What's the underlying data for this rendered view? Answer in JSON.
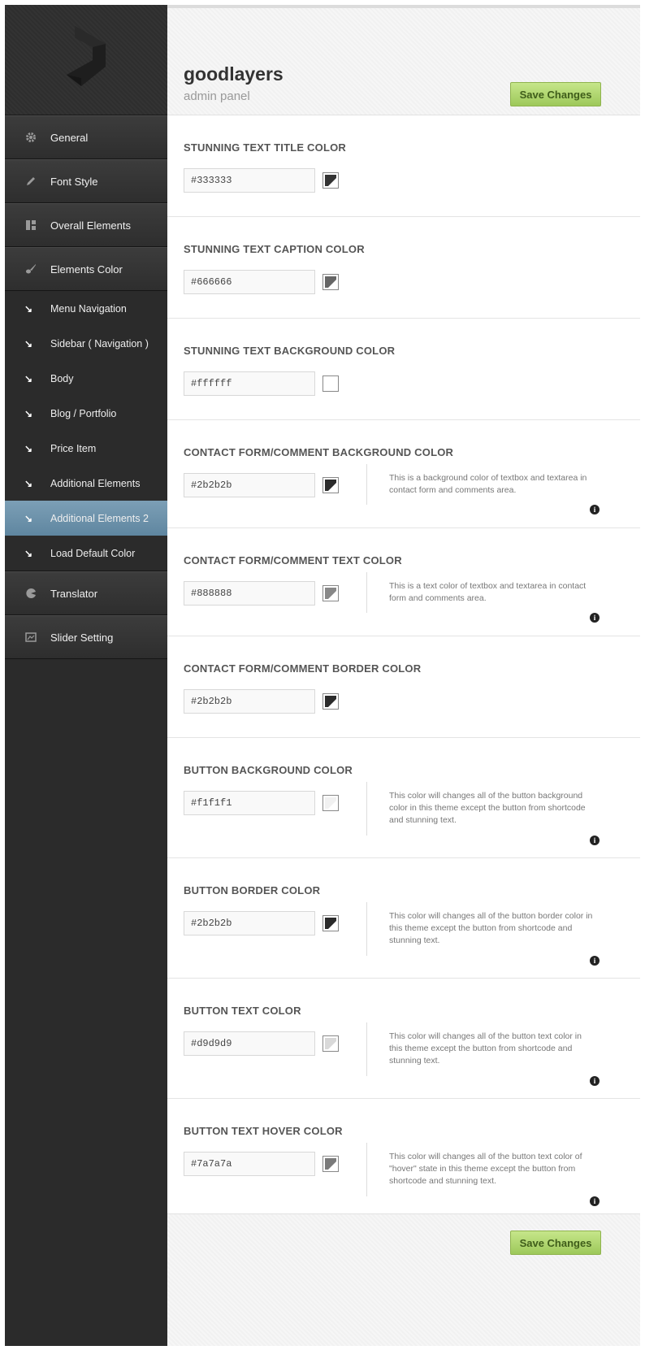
{
  "header": {
    "title": "goodlayers",
    "subtitle": "admin panel",
    "save_label": "Save Changes"
  },
  "footer": {
    "save_label": "Save Changes"
  },
  "sidebar": {
    "top_items": [
      {
        "label": "General",
        "icon": "gear-icon"
      },
      {
        "label": "Font Style",
        "icon": "pencil-icon"
      },
      {
        "label": "Overall Elements",
        "icon": "layout-icon"
      },
      {
        "label": "Elements Color",
        "icon": "brush-icon"
      }
    ],
    "sub_items": [
      {
        "label": "Menu Navigation",
        "active": false
      },
      {
        "label": "Sidebar ( Navigation )",
        "active": false
      },
      {
        "label": "Body",
        "active": false
      },
      {
        "label": "Blog / Portfolio",
        "active": false
      },
      {
        "label": "Price Item",
        "active": false
      },
      {
        "label": "Additional Elements",
        "active": false
      },
      {
        "label": "Additional Elements 2",
        "active": true
      },
      {
        "label": "Load Default Color",
        "active": false
      }
    ],
    "bottom_items": [
      {
        "label": "Translator",
        "icon": "pie-chart-icon"
      },
      {
        "label": "Slider Setting",
        "icon": "slides-icon"
      }
    ]
  },
  "options": [
    {
      "title": "STUNNING TEXT TITLE COLOR",
      "value": "#333333",
      "color": "#333333",
      "description": ""
    },
    {
      "title": "STUNNING TEXT CAPTION COLOR",
      "value": "#666666",
      "color": "#666666",
      "description": ""
    },
    {
      "title": "STUNNING TEXT BACKGROUND COLOR",
      "value": "#ffffff",
      "color": "#ffffff",
      "description": ""
    },
    {
      "title": "CONTACT FORM/COMMENT BACKGROUND COLOR",
      "value": "#2b2b2b",
      "color": "#2b2b2b",
      "description": "This is a background color of textbox and textarea in contact form and comments area."
    },
    {
      "title": "CONTACT FORM/COMMENT TEXT COLOR",
      "value": "#888888",
      "color": "#888888",
      "description": "This is a text color of textbox and textarea in contact form and comments area."
    },
    {
      "title": "CONTACT FORM/COMMENT BORDER COLOR",
      "value": "#2b2b2b",
      "color": "#2b2b2b",
      "description": ""
    },
    {
      "title": "BUTTON BACKGROUND COLOR",
      "value": "#f1f1f1",
      "color": "#f1f1f1",
      "description": "This color will changes all of the button background color in this theme except the button from shortcode and stunning text."
    },
    {
      "title": "BUTTON BORDER COLOR",
      "value": "#2b2b2b",
      "color": "#2b2b2b",
      "description": "This color will changes all of the button border color in this theme except the button from shortcode and stunning text."
    },
    {
      "title": "BUTTON TEXT COLOR",
      "value": "#d9d9d9",
      "color": "#d9d9d9",
      "description": "This color will changes all of the button text color in this theme except the button from shortcode and stunning text."
    },
    {
      "title": "BUTTON TEXT HOVER COLOR",
      "value": "#7a7a7a",
      "color": "#7a7a7a",
      "description": "This color will changes all of the button text color of \"hover\" state in this theme except the button from shortcode and stunning text."
    }
  ],
  "colors": {
    "sidebar_bg": "#2b2b2b",
    "active_item": "#6f93ab",
    "save_button": "#aed36c"
  }
}
